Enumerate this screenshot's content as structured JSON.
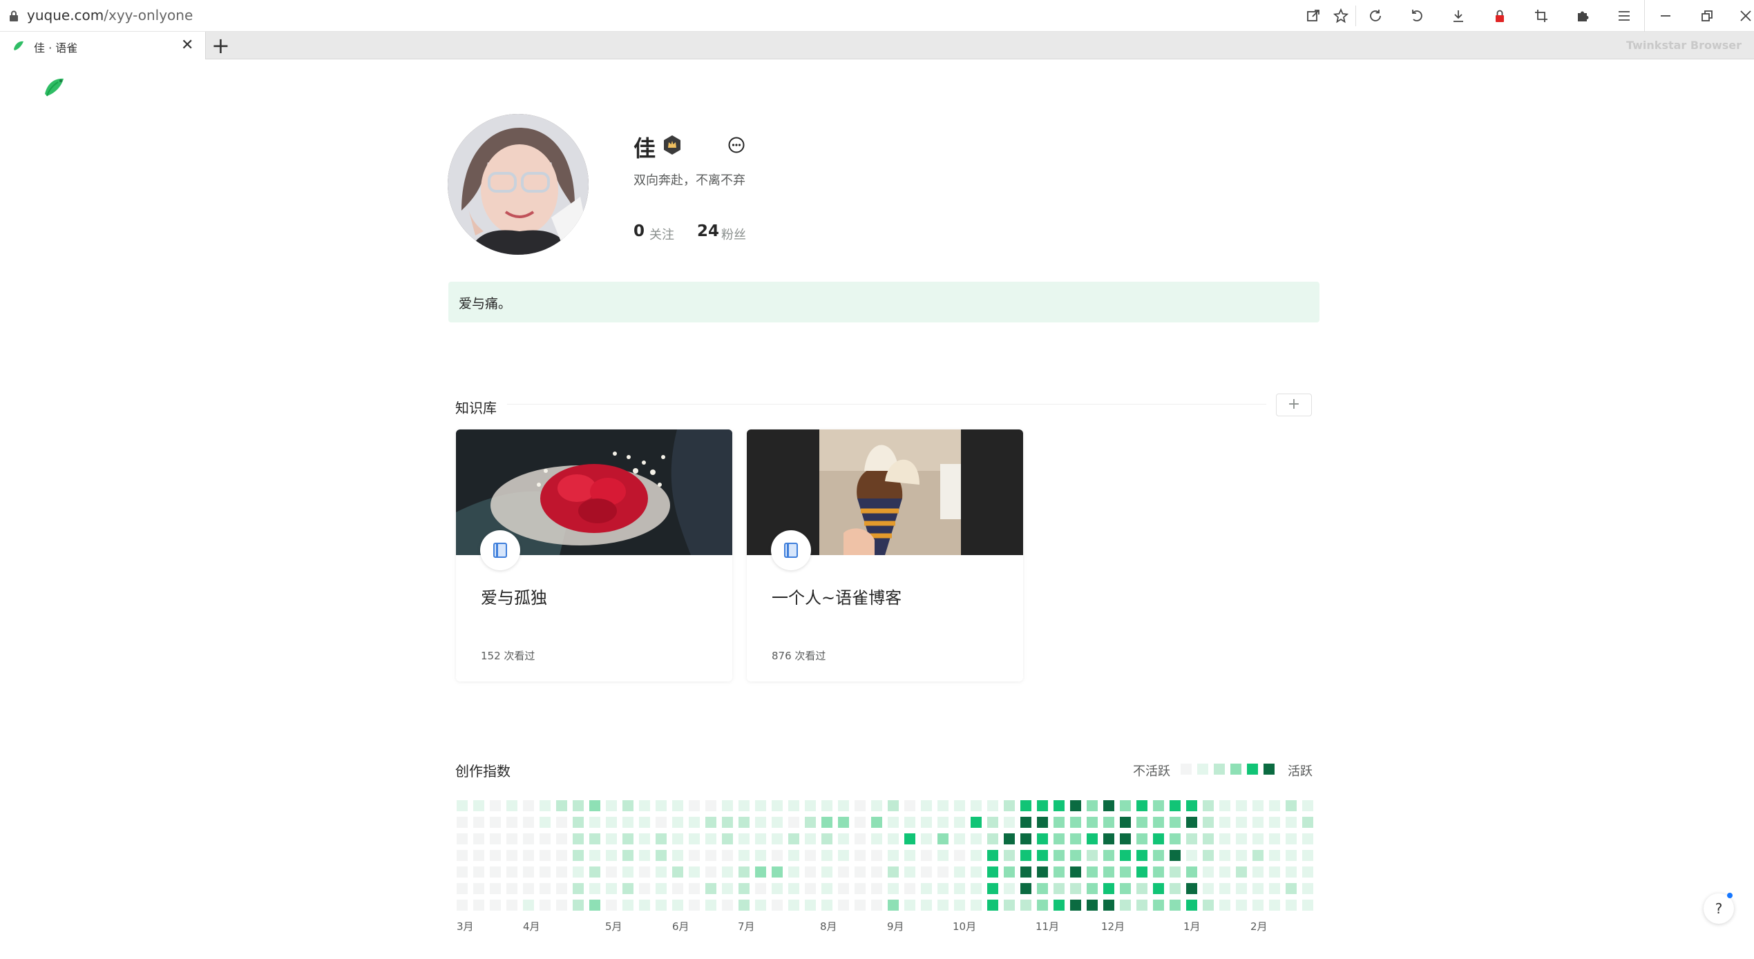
{
  "browser": {
    "url_host": "yuque.com",
    "url_path": "/xyy-onlyone",
    "tab_title": "佳 · 语雀",
    "new_tab": "+",
    "tab_close": "✕",
    "brand": "Twinkstar Browser"
  },
  "profile": {
    "name": "佳",
    "bio": "双向奔赴，不离不弃",
    "following_count": "0",
    "following_label": "关注",
    "followers_count": "24",
    "followers_label": "粉丝"
  },
  "notice": {
    "text": "爱与痛。"
  },
  "knowledge": {
    "title": "知识库",
    "add_label": "+",
    "cards": [
      {
        "title": "爱与孤独",
        "views": "152 次看过"
      },
      {
        "title": "一个人~语雀博客",
        "views": "876 次看过"
      }
    ]
  },
  "activity": {
    "title": "创作指数",
    "legend_low": "不活跃",
    "legend_high": "活跃",
    "colors": [
      "#f3f4f4",
      "#e3f6ec",
      "#c0ebd3",
      "#8ee0b5",
      "#11c476",
      "#0b6b41"
    ],
    "months": [
      "3月",
      "4月",
      "5月",
      "6月",
      "7月",
      "8月",
      "9月",
      "10月",
      "11月",
      "12月",
      "1月",
      "2月"
    ],
    "week_levels": [
      [
        1,
        0,
        0,
        0,
        0,
        0,
        0
      ],
      [
        1,
        0,
        0,
        0,
        0,
        0,
        0
      ],
      [
        0,
        0,
        0,
        0,
        0,
        0,
        0
      ],
      [
        1,
        0,
        0,
        0,
        0,
        0,
        0
      ],
      [
        0,
        0,
        0,
        0,
        0,
        0,
        1
      ],
      [
        1,
        1,
        0,
        0,
        0,
        0,
        0
      ],
      [
        2,
        0,
        0,
        0,
        0,
        0,
        0
      ],
      [
        2,
        2,
        2,
        2,
        1,
        2,
        2
      ],
      [
        3,
        1,
        2,
        1,
        2,
        1,
        3
      ],
      [
        1,
        1,
        1,
        1,
        0,
        1,
        0
      ],
      [
        2,
        1,
        2,
        2,
        1,
        2,
        1
      ],
      [
        1,
        1,
        1,
        1,
        0,
        0,
        1
      ],
      [
        1,
        0,
        2,
        2,
        1,
        1,
        1
      ],
      [
        1,
        1,
        1,
        1,
        2,
        0,
        1
      ],
      [
        0,
        1,
        1,
        0,
        1,
        0,
        0
      ],
      [
        0,
        2,
        1,
        0,
        0,
        2,
        1
      ],
      [
        1,
        2,
        2,
        0,
        1,
        1,
        0
      ],
      [
        1,
        2,
        1,
        1,
        2,
        2,
        2
      ],
      [
        1,
        1,
        1,
        1,
        3,
        0,
        1
      ],
      [
        1,
        1,
        1,
        0,
        3,
        1,
        0
      ],
      [
        1,
        0,
        2,
        1,
        1,
        1,
        1
      ],
      [
        1,
        2,
        1,
        0,
        0,
        0,
        1
      ],
      [
        1,
        3,
        2,
        1,
        1,
        1,
        1
      ],
      [
        1,
        3,
        1,
        1,
        0,
        0,
        0
      ],
      [
        0,
        0,
        0,
        0,
        0,
        0,
        0
      ],
      [
        1,
        3,
        1,
        0,
        0,
        0,
        0
      ],
      [
        2,
        1,
        1,
        1,
        2,
        1,
        3
      ],
      [
        0,
        1,
        4,
        1,
        1,
        0,
        1
      ],
      [
        1,
        1,
        1,
        0,
        0,
        1,
        1
      ],
      [
        1,
        1,
        3,
        1,
        0,
        1,
        1
      ],
      [
        1,
        1,
        1,
        0,
        1,
        1,
        1
      ],
      [
        1,
        4,
        1,
        1,
        1,
        1,
        1
      ],
      [
        1,
        2,
        2,
        4,
        4,
        4,
        4
      ],
      [
        2,
        1,
        5,
        2,
        3,
        1,
        2
      ],
      [
        4,
        5,
        5,
        4,
        5,
        5,
        2
      ],
      [
        4,
        5,
        4,
        4,
        5,
        3,
        3
      ],
      [
        4,
        3,
        3,
        3,
        3,
        2,
        4
      ],
      [
        5,
        3,
        3,
        3,
        5,
        2,
        5
      ],
      [
        3,
        3,
        4,
        2,
        3,
        3,
        5
      ],
      [
        5,
        3,
        5,
        3,
        3,
        4,
        5
      ],
      [
        3,
        5,
        5,
        4,
        3,
        3,
        2
      ],
      [
        4,
        3,
        3,
        4,
        4,
        2,
        2
      ],
      [
        3,
        3,
        4,
        3,
        3,
        4,
        3
      ],
      [
        4,
        3,
        3,
        5,
        2,
        2,
        3
      ],
      [
        4,
        5,
        2,
        1,
        3,
        5,
        4
      ],
      [
        2,
        2,
        2,
        2,
        1,
        1,
        2
      ],
      [
        1,
        1,
        1,
        1,
        1,
        1,
        1
      ],
      [
        1,
        1,
        1,
        1,
        2,
        1,
        1
      ],
      [
        1,
        1,
        1,
        2,
        1,
        1,
        1
      ],
      [
        1,
        1,
        1,
        1,
        1,
        1,
        1
      ],
      [
        2,
        1,
        1,
        1,
        1,
        2,
        1
      ],
      [
        1,
        2,
        1,
        1,
        1,
        1,
        1
      ]
    ]
  }
}
